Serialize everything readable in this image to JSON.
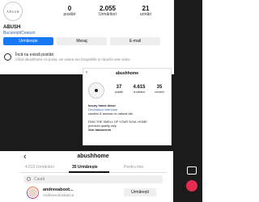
{
  "profile_top": {
    "logo_text": "ABUSH",
    "stats": [
      {
        "value": "0",
        "label": "postări"
      },
      {
        "value": "2.055",
        "label": "Urmăritori"
      },
      {
        "value": "21",
        "label": "urmări"
      }
    ],
    "name": "ABUSH",
    "location": "București/Ceasuri",
    "buttons": {
      "follow": "Urmărește",
      "message": "Mesaj",
      "email": "E-mail"
    },
    "empty_title": "Încă nu există postări",
    "empty_body": "Când abushhome va posta, vei vedea aici fotografiile și clipurile sale video."
  },
  "profile_mid": {
    "title": "abushhome",
    "stats": [
      {
        "value": "37",
        "label": "postări"
      },
      {
        "value": "4.615",
        "label": "urmăritori"
      },
      {
        "value": "35",
        "label": "urmăriri"
      }
    ],
    "bio_lines": [
      "luxury home decor",
      "Decorațiuni interioare",
      "candles & aromas on natural oils",
      "",
      "FIND THE SMELL OF YOUR SOUL HOME",
      "premium quality only",
      "Vezi traducerea"
    ]
  },
  "following": {
    "back_icon": "chevron-left-icon",
    "title": "abushhome",
    "tabs": [
      "4.615 Urmăritori",
      "35 Urmărește",
      "Pentru tine"
    ],
    "search_placeholder": "Caută",
    "rows": [
      {
        "username": "andreeaboot...",
        "fullname": "Andreea Bostanica",
        "action": "Urmărești"
      }
    ]
  }
}
